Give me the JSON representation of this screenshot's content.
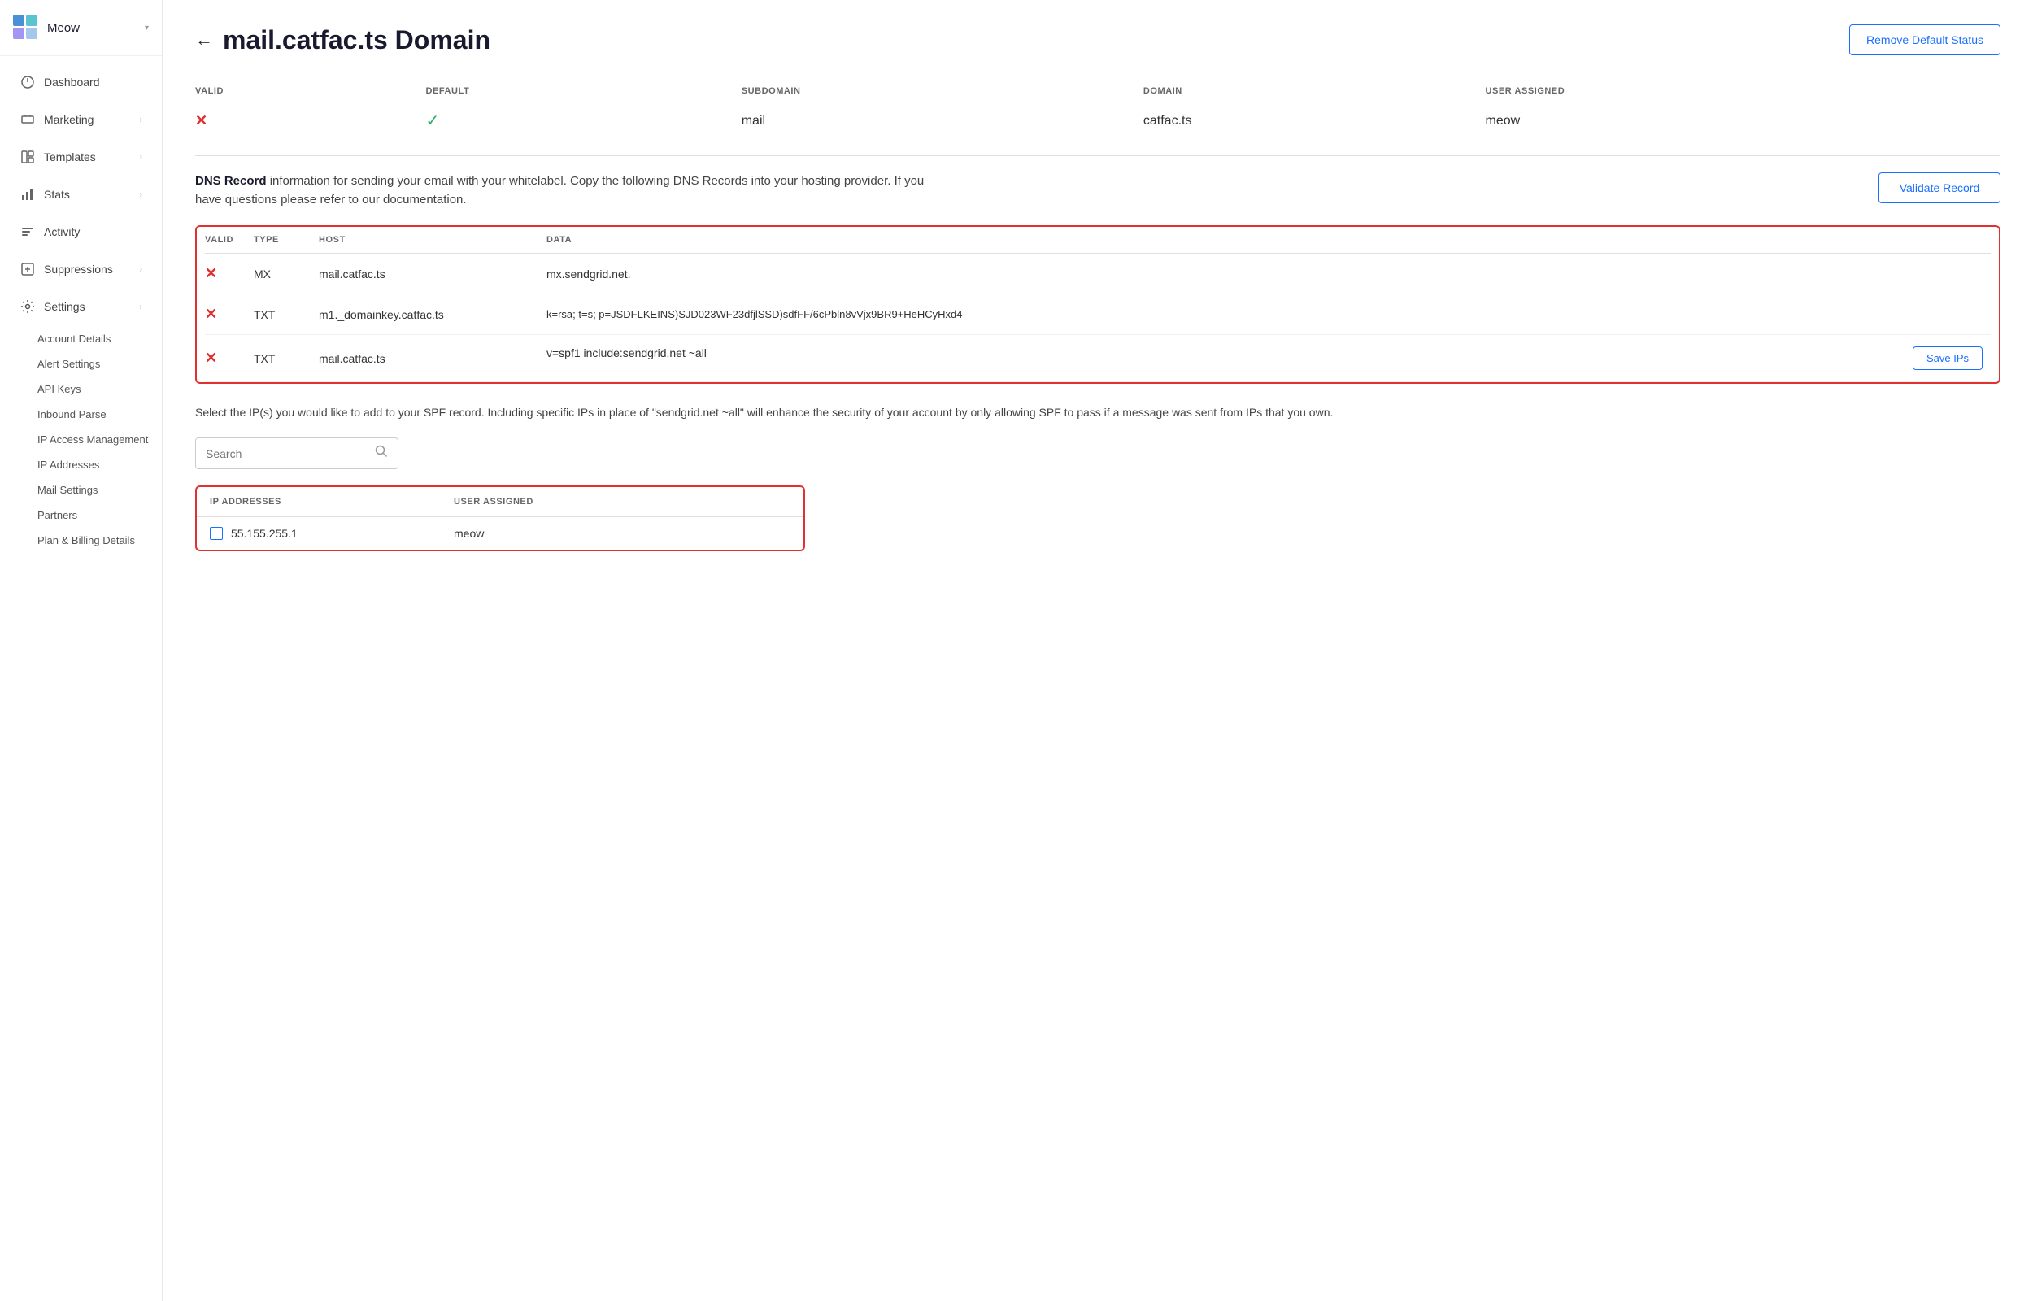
{
  "sidebar": {
    "account": {
      "name": "Meow"
    },
    "nav": [
      {
        "id": "dashboard",
        "label": "Dashboard",
        "icon": "dashboard-icon",
        "hasChildren": false
      },
      {
        "id": "marketing",
        "label": "Marketing",
        "icon": "marketing-icon",
        "hasChildren": true
      },
      {
        "id": "templates",
        "label": "Templates",
        "icon": "templates-icon",
        "hasChildren": true
      },
      {
        "id": "stats",
        "label": "Stats",
        "icon": "stats-icon",
        "hasChildren": true
      },
      {
        "id": "activity",
        "label": "Activity",
        "icon": "activity-icon",
        "hasChildren": false
      },
      {
        "id": "suppressions",
        "label": "Suppressions",
        "icon": "suppressions-icon",
        "hasChildren": true
      },
      {
        "id": "settings",
        "label": "Settings",
        "icon": "settings-icon",
        "hasChildren": true
      }
    ],
    "settings_sub": [
      {
        "id": "account-details",
        "label": "Account Details"
      },
      {
        "id": "alert-settings",
        "label": "Alert Settings"
      },
      {
        "id": "api-keys",
        "label": "API Keys"
      },
      {
        "id": "inbound-parse",
        "label": "Inbound Parse"
      },
      {
        "id": "ip-access-management",
        "label": "IP Access Management"
      },
      {
        "id": "ip-addresses",
        "label": "IP Addresses"
      },
      {
        "id": "mail-settings",
        "label": "Mail Settings"
      },
      {
        "id": "partners",
        "label": "Partners"
      },
      {
        "id": "plan-billing",
        "label": "Plan & Billing Details"
      }
    ]
  },
  "page": {
    "back_label": "←",
    "title": "mail.catfac.ts Domain",
    "remove_default_btn": "Remove Default Status"
  },
  "domain_info": {
    "cols": [
      "VALID",
      "DEFAULT",
      "SUBDOMAIN",
      "DOMAIN",
      "USER ASSIGNED"
    ],
    "row": {
      "valid": "✕",
      "default": "✓",
      "subdomain": "mail",
      "domain": "catfac.ts",
      "user_assigned": "meow"
    }
  },
  "dns_section": {
    "info_text_bold": "DNS Record",
    "info_text": " information for sending your email with your whitelabel. Copy the following DNS Records into your hosting provider. If you have questions please refer to our documentation.",
    "validate_btn": "Validate Record",
    "table": {
      "cols": [
        "VALID",
        "TYPE",
        "HOST",
        "DATA"
      ],
      "rows": [
        {
          "valid": "✕",
          "type": "MX",
          "host": "mail.catfac.ts",
          "data": "mx.sendgrid.net."
        },
        {
          "valid": "✕",
          "type": "TXT",
          "host": "m1._domainkey.catfac.ts",
          "data": "k=rsa; t=s; p=JSDFLKEINS)SJD023WF23dfjlSSD)sdfFF/6cPbln8vVjx9BR9+HeHCyHxd4"
        },
        {
          "valid": "✕",
          "type": "TXT",
          "host": "mail.catfac.ts",
          "data": "v=spf1 include:sendgrid.net ~all",
          "has_save": true
        }
      ]
    }
  },
  "spf_section": {
    "description": "Select the IP(s) you would like to add to your SPF record. Including specific IPs in place of \"sendgrid.net ~all\" will enhance the security of your account by only allowing SPF to pass if a message was sent from IPs that you own.",
    "search_placeholder": "Search",
    "save_ips_btn": "Save IPs",
    "ip_table": {
      "cols": [
        "IP ADDRESSES",
        "USER ASSIGNED"
      ],
      "rows": [
        {
          "ip": "55.155.255.1",
          "user_assigned": "meow",
          "checked": false
        }
      ]
    }
  }
}
